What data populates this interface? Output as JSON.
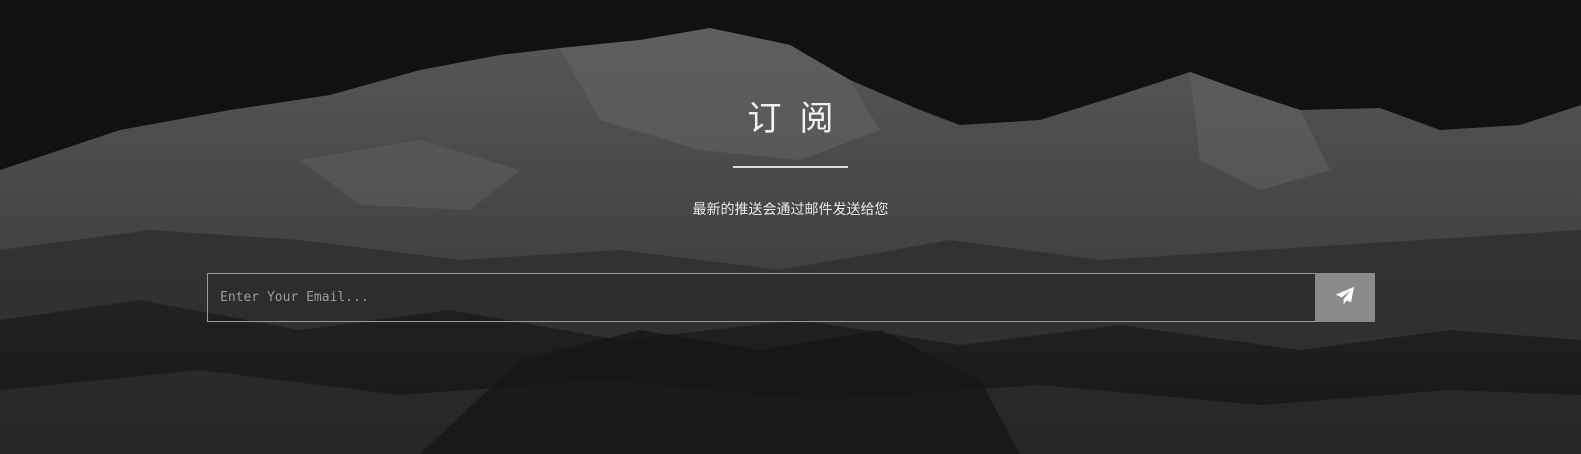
{
  "subscribe": {
    "title": "订阅",
    "subtitle": "最新的推送会通过邮件发送给您",
    "email_placeholder": "Enter Your Email...",
    "send_icon": "paper-plane-icon"
  },
  "colors": {
    "button_bg": "#8a8a8a",
    "text": "#f2f2f2",
    "border": "#9a9a9a"
  }
}
